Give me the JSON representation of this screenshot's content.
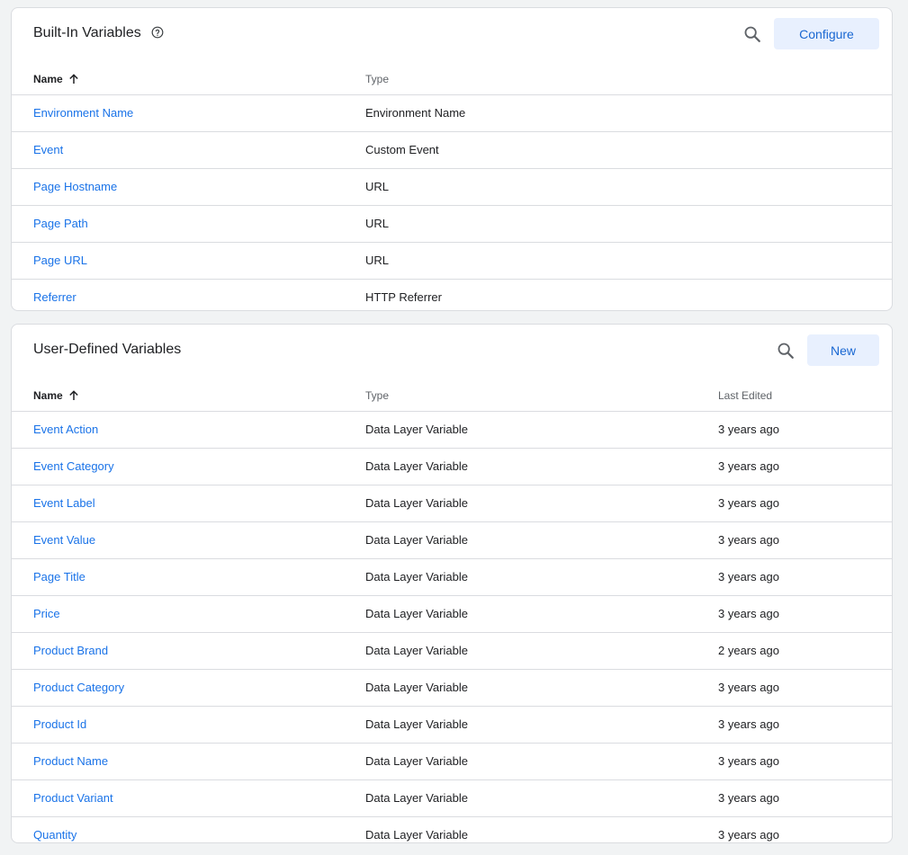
{
  "builtin": {
    "title": "Built-In Variables",
    "help_icon": "help-circle-icon",
    "configure_label": "Configure",
    "columns": {
      "name": "Name",
      "type": "Type"
    },
    "rows": [
      {
        "name": "Environment Name",
        "type": "Environment Name"
      },
      {
        "name": "Event",
        "type": "Custom Event"
      },
      {
        "name": "Page Hostname",
        "type": "URL"
      },
      {
        "name": "Page Path",
        "type": "URL"
      },
      {
        "name": "Page URL",
        "type": "URL"
      },
      {
        "name": "Referrer",
        "type": "HTTP Referrer"
      }
    ]
  },
  "userdefined": {
    "title": "User-Defined Variables",
    "new_label": "New",
    "columns": {
      "name": "Name",
      "type": "Type",
      "last_edited": "Last Edited"
    },
    "rows": [
      {
        "name": "Event Action",
        "type": "Data Layer Variable",
        "last_edited": "3 years ago"
      },
      {
        "name": "Event Category",
        "type": "Data Layer Variable",
        "last_edited": "3 years ago"
      },
      {
        "name": "Event Label",
        "type": "Data Layer Variable",
        "last_edited": "3 years ago"
      },
      {
        "name": "Event Value",
        "type": "Data Layer Variable",
        "last_edited": "3 years ago"
      },
      {
        "name": "Page Title",
        "type": "Data Layer Variable",
        "last_edited": "3 years ago"
      },
      {
        "name": "Price",
        "type": "Data Layer Variable",
        "last_edited": "3 years ago"
      },
      {
        "name": "Product Brand",
        "type": "Data Layer Variable",
        "last_edited": "2 years ago"
      },
      {
        "name": "Product Category",
        "type": "Data Layer Variable",
        "last_edited": "3 years ago"
      },
      {
        "name": "Product Id",
        "type": "Data Layer Variable",
        "last_edited": "3 years ago"
      },
      {
        "name": "Product Name",
        "type": "Data Layer Variable",
        "last_edited": "3 years ago"
      },
      {
        "name": "Product Variant",
        "type": "Data Layer Variable",
        "last_edited": "3 years ago"
      },
      {
        "name": "Quantity",
        "type": "Data Layer Variable",
        "last_edited": "3 years ago"
      }
    ]
  },
  "colors": {
    "link": "#1a73e8",
    "button_bg": "#e8f0fe",
    "button_text": "#1967d2",
    "page_bg": "#f1f3f4",
    "border": "#dadce0"
  }
}
